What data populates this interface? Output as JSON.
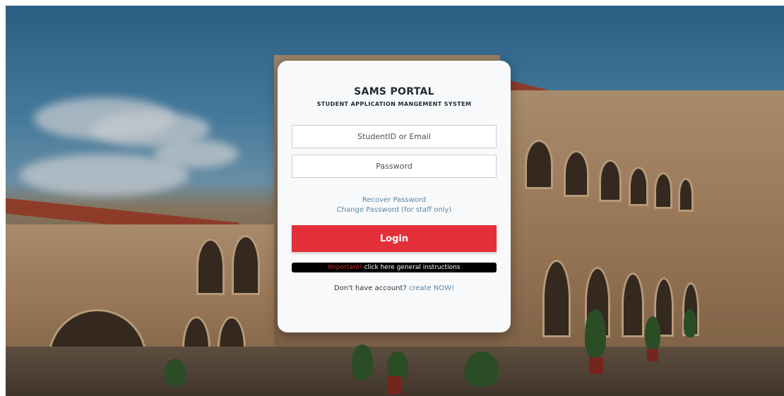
{
  "brand": {
    "title": "SAMS PORTAL",
    "subtitle": "STUDENT APPLICATION MANGEMENT SYSTEM"
  },
  "form": {
    "userid_placeholder": "StudentID or Email",
    "password_placeholder": "Password",
    "login_label": "Login"
  },
  "links": {
    "recover": "Recover Password",
    "change": "Change Password (for staff only)"
  },
  "instructions": {
    "important": "Important!",
    "text": " click here general instructions"
  },
  "signup": {
    "prompt": "Don't have account? ",
    "link": "create NOW!"
  },
  "colors": {
    "accent": "#e43038",
    "link": "#5b87a3",
    "card": "#f8f9fa"
  }
}
